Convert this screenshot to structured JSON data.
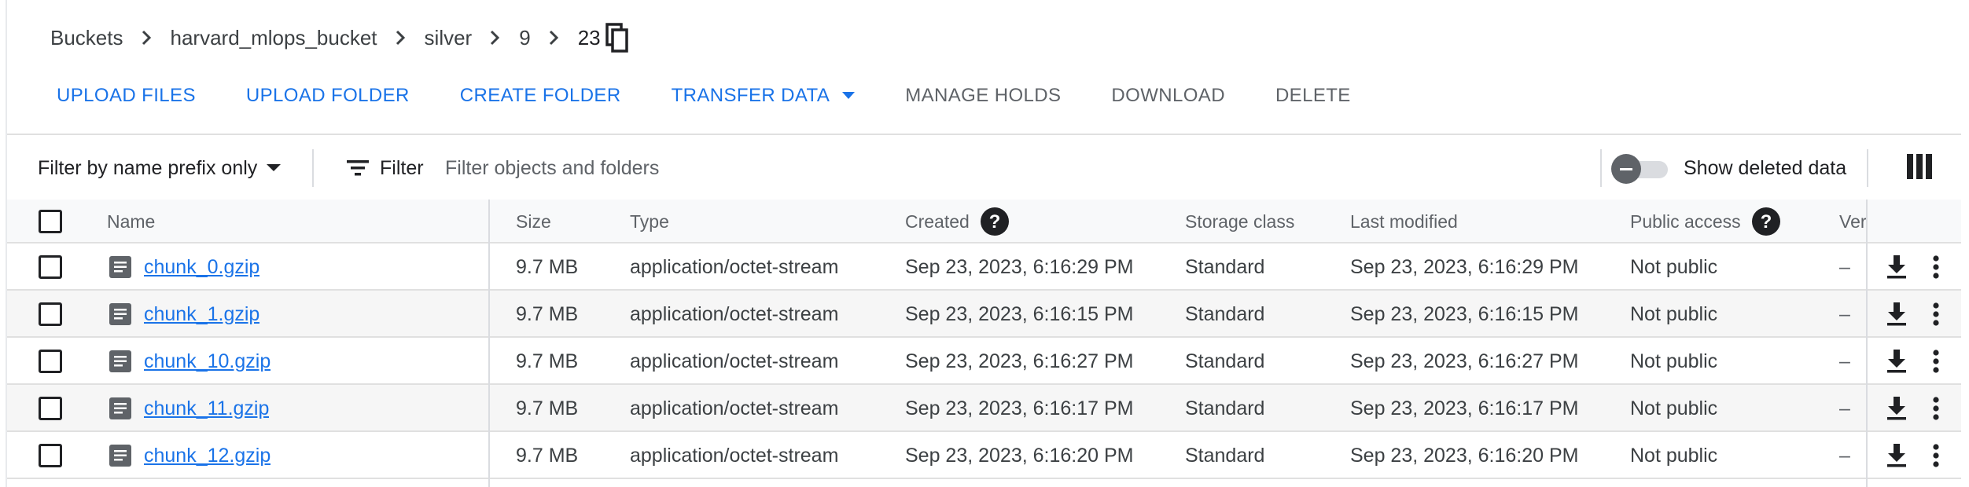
{
  "breadcrumb": {
    "items": [
      "Buckets",
      "harvard_mlops_bucket",
      "silver",
      "9"
    ],
    "current": "23"
  },
  "toolbar": {
    "upload_files": "UPLOAD FILES",
    "upload_folder": "UPLOAD FOLDER",
    "create_folder": "CREATE FOLDER",
    "transfer_data": "TRANSFER DATA",
    "manage_holds": "MANAGE HOLDS",
    "download": "DOWNLOAD",
    "delete": "DELETE"
  },
  "filter": {
    "prefix_mode": "Filter by name prefix only",
    "label": "Filter",
    "placeholder": "Filter objects and folders",
    "show_deleted_label": "Show deleted data",
    "show_deleted_on": false
  },
  "table": {
    "headers": {
      "name": "Name",
      "size": "Size",
      "type": "Type",
      "created": "Created",
      "storage_class": "Storage class",
      "last_modified": "Last modified",
      "public_access": "Public access",
      "version": "Ver"
    },
    "rows": [
      {
        "name": "chunk_0.gzip",
        "size": "9.7 MB",
        "type": "application/octet-stream",
        "created": "Sep 23, 2023, 6:16:29 PM",
        "storage_class": "Standard",
        "last_modified": "Sep 23, 2023, 6:16:29 PM",
        "public_access": "Not public",
        "version": "–"
      },
      {
        "name": "chunk_1.gzip",
        "size": "9.7 MB",
        "type": "application/octet-stream",
        "created": "Sep 23, 2023, 6:16:15 PM",
        "storage_class": "Standard",
        "last_modified": "Sep 23, 2023, 6:16:15 PM",
        "public_access": "Not public",
        "version": "–"
      },
      {
        "name": "chunk_10.gzip",
        "size": "9.7 MB",
        "type": "application/octet-stream",
        "created": "Sep 23, 2023, 6:16:27 PM",
        "storage_class": "Standard",
        "last_modified": "Sep 23, 2023, 6:16:27 PM",
        "public_access": "Not public",
        "version": "–"
      },
      {
        "name": "chunk_11.gzip",
        "size": "9.7 MB",
        "type": "application/octet-stream",
        "created": "Sep 23, 2023, 6:16:17 PM",
        "storage_class": "Standard",
        "last_modified": "Sep 23, 2023, 6:16:17 PM",
        "public_access": "Not public",
        "version": "–"
      },
      {
        "name": "chunk_12.gzip",
        "size": "9.7 MB",
        "type": "application/octet-stream",
        "created": "Sep 23, 2023, 6:16:20 PM",
        "storage_class": "Standard",
        "last_modified": "Sep 23, 2023, 6:16:20 PM",
        "public_access": "Not public",
        "version": "–"
      }
    ]
  },
  "colors": {
    "accent": "#1a73e8",
    "disabled_text": "#5f6368",
    "header_bg": "#f8f9fa",
    "alt_row_bg": "#f6f6f6"
  },
  "icons": {
    "breadcrumb_separator": "chevron-right-icon",
    "copy": "copy-icon",
    "dropdown": "caret-down-icon",
    "filter": "filter-list-icon",
    "columns": "column-view-icon",
    "help": "help-circle-icon",
    "file": "file-document-icon",
    "download": "download-icon",
    "more": "more-vert-icon"
  }
}
